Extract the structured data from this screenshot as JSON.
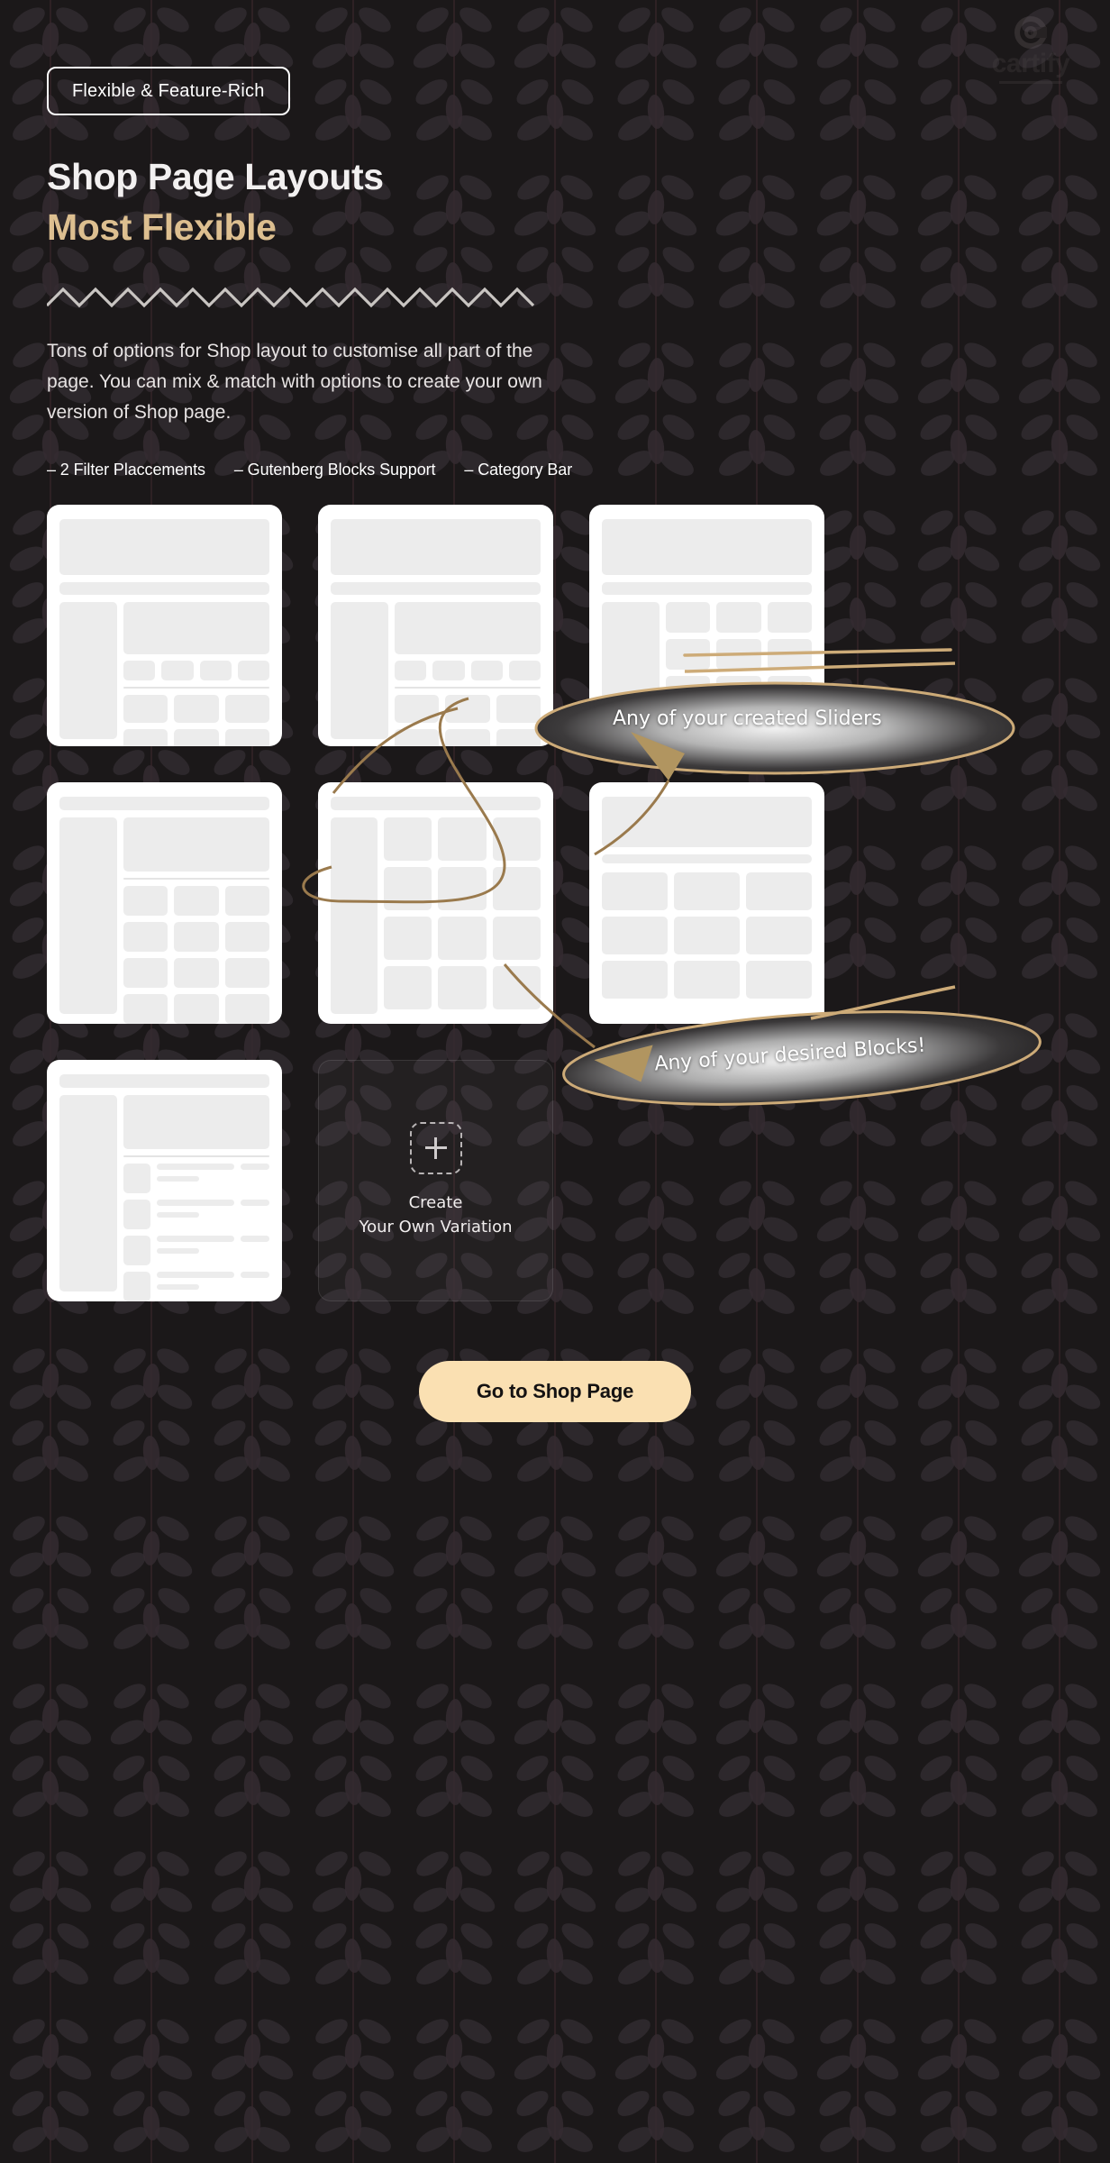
{
  "brand": {
    "logo_word": "cartify",
    "logo_mark": "c-circle-icon"
  },
  "hero": {
    "badge": "Flexible & Feature-Rich",
    "title": "Shop Page Layouts",
    "subtitle": "Most Flexible",
    "description": "Tons of options for Shop layout to customise all part of the page. You can mix & match with options to create your own version of Shop page.",
    "features": [
      "– 2 Filter Placcements",
      "– Gutenberg Blocks Support",
      "– Category Bar"
    ]
  },
  "annotations": [
    {
      "id": "sliders",
      "text": "Any of your created Sliders"
    },
    {
      "id": "blocks",
      "text": "Any of your desired Blocks!"
    }
  ],
  "create_card": {
    "plus_icon": "plus-icon",
    "line1": "Create",
    "line2": "Your Own Variation"
  },
  "cta": {
    "label": "Go to Shop Page"
  },
  "colors": {
    "background": "#1b1819",
    "accent_gold": "#ddbf90",
    "cta_background": "#fae0b2",
    "cta_text": "#141212",
    "card_background": "#ffffff",
    "wireframe_block": "#ececec",
    "heading_white": "#f2f0f0"
  },
  "layout_cards": [
    {
      "id": "card-1",
      "name": "banner-sidebar-category-grid"
    },
    {
      "id": "card-2",
      "name": "banner-topbar-category-grid"
    },
    {
      "id": "card-3",
      "name": "banner-sidebar-grid"
    },
    {
      "id": "card-4",
      "name": "topbar-sidebar-hero-grid"
    },
    {
      "id": "card-5",
      "name": "sidebar-grid-four-column"
    },
    {
      "id": "card-6",
      "name": "banner-wide-grid"
    },
    {
      "id": "card-7",
      "name": "sidebar-list-view"
    }
  ]
}
